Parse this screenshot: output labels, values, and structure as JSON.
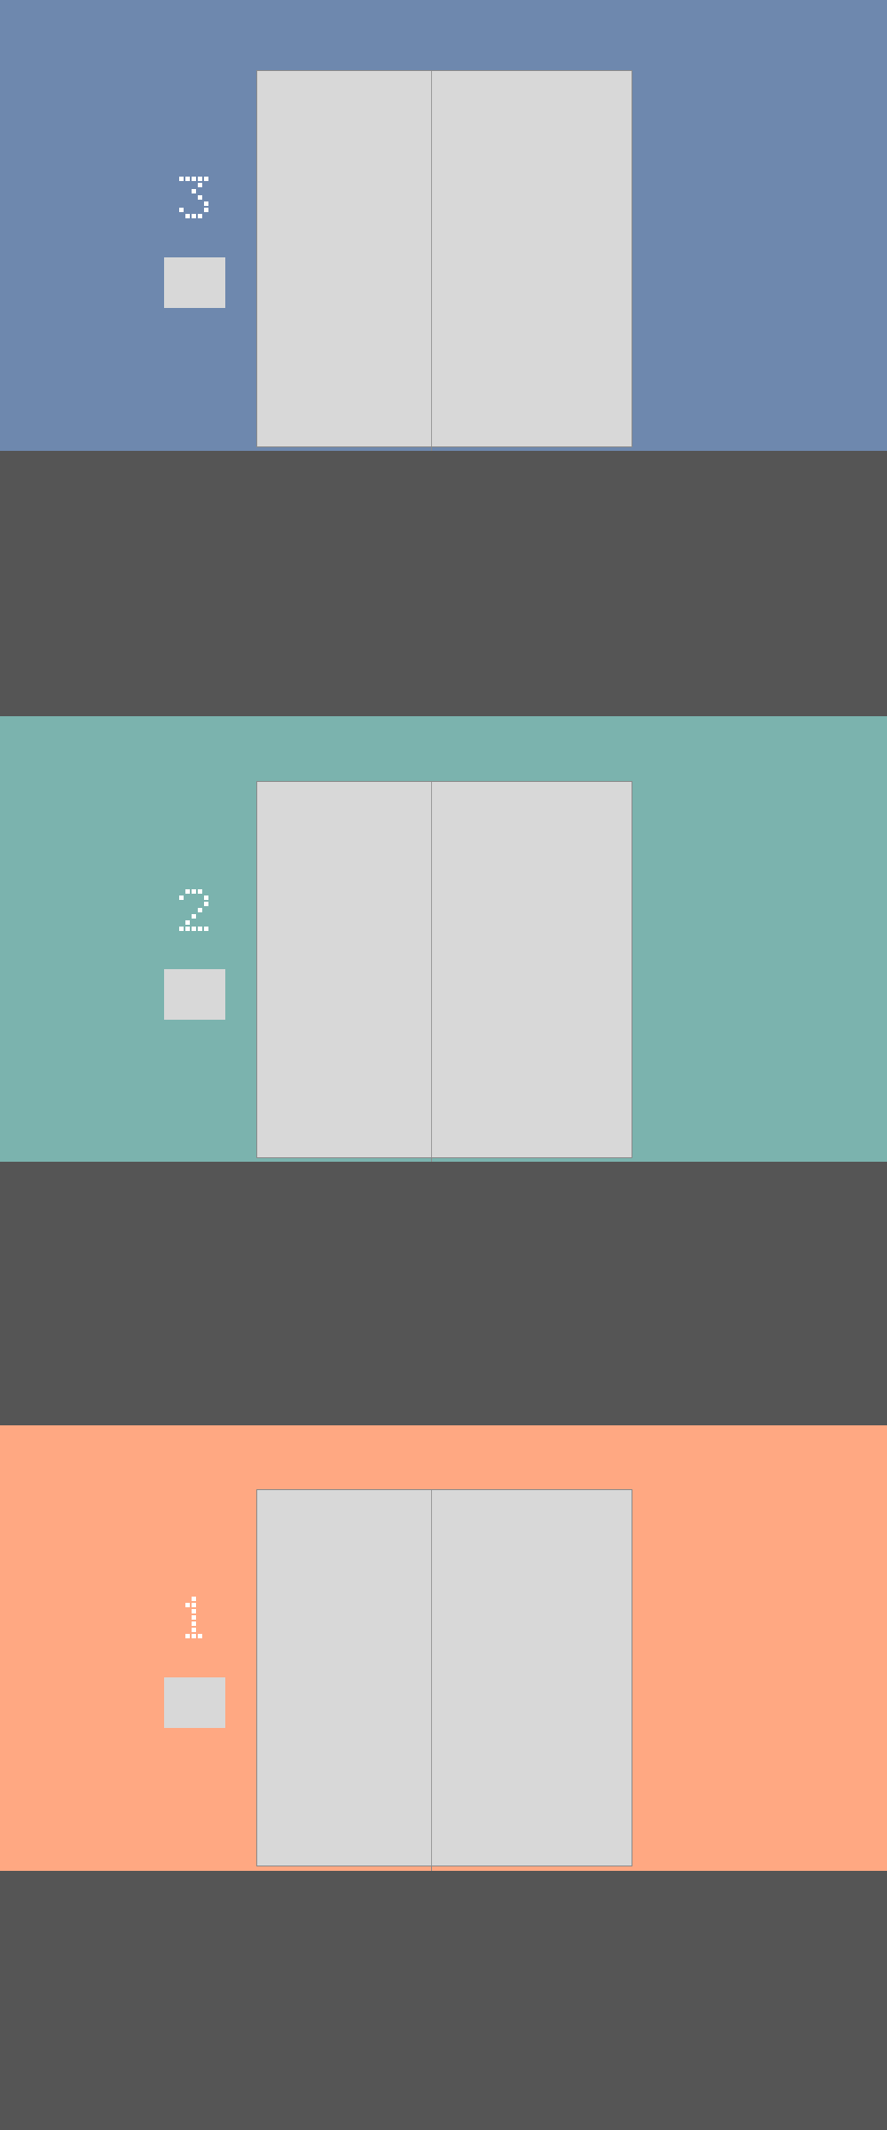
{
  "floors": [
    {
      "number": "3",
      "color": "#6e88ae"
    },
    {
      "number": "2",
      "color": "#7bb3ae"
    },
    {
      "number": "1",
      "color": "#ffa882"
    }
  ],
  "colors": {
    "shaft": "#555555",
    "door": "#d8d8d8",
    "door_border": "#8a8a8a",
    "floor_digit": "#ffffff",
    "call_button": "#d8d8d8"
  },
  "icons": {
    "call_button": "square-button-icon",
    "floor_digit": "pixel-digit-icon"
  }
}
